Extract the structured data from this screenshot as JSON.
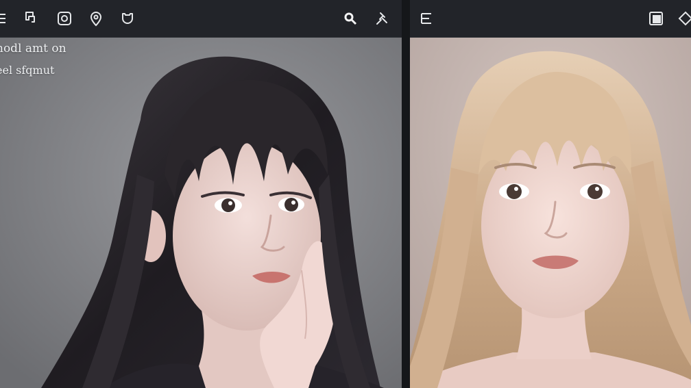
{
  "left_panel": {
    "toolbar_icons": [
      "menu-icon",
      "export-icon",
      "frame-icon",
      "location-pin-icon",
      "shield-icon",
      "search-icon",
      "pin-icon"
    ],
    "overlay_lines": [
      "hodl amt on",
      "eel sfqmut"
    ],
    "photo": {
      "subject": "portrait",
      "hair_color": "#2a262b",
      "background_color": "#8b8c90"
    }
  },
  "right_panel": {
    "toolbar_icons": [
      "menu-icon",
      "layers-icon",
      "diamond-icon"
    ],
    "photo": {
      "subject": "portrait",
      "hair_color": "#cfae8e",
      "background_color": "#c2b2ad"
    }
  },
  "colors": {
    "toolbar_bg": "#222429",
    "divider": "#15171a",
    "icon": "#e6e8ea"
  }
}
